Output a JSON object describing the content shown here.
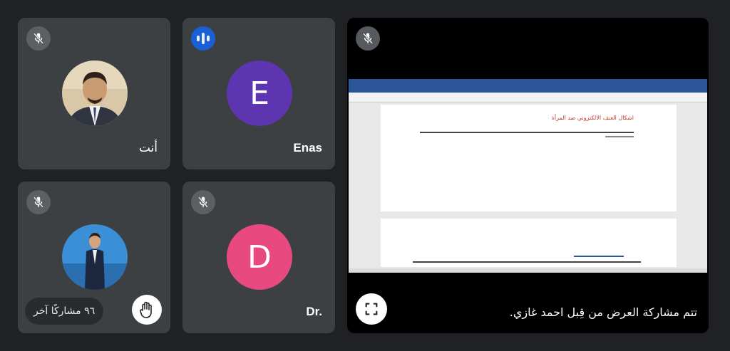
{
  "tiles": {
    "you": {
      "name": "أنت",
      "mic": "mic-off-icon"
    },
    "enas": {
      "initial": "E",
      "name": "Enas",
      "avatar_color": "#5e35b1",
      "mic": "speaking-indicator-icon"
    },
    "others": {
      "label": "٩٦ مشاركًا آخر",
      "mic": "mic-off-icon",
      "hand": "raised-hand-icon"
    },
    "dr": {
      "initial": "D",
      "name": "Dr.",
      "avatar_color": "#e84a7f",
      "mic": "mic-off-icon"
    }
  },
  "presentation": {
    "caption": "تتم مشاركة العرض من قِبل احمد غازي.",
    "doc_heading": "اشكال العنف الالكتروني ضد المرأة",
    "fullscreen_icon": "fullscreen-icon",
    "mic": "mic-off-icon"
  },
  "colors": {
    "background": "#202124",
    "tile": "#3c4043",
    "speaking": "#1a5fd3"
  }
}
